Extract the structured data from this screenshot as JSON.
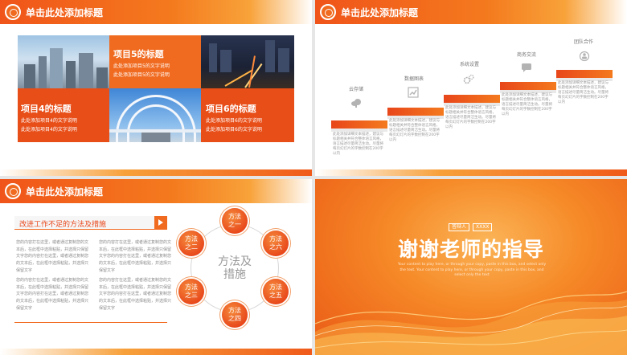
{
  "header_title": "单击此处添加标题",
  "slide1": {
    "tiles": [
      {
        "title": "项目5的标题",
        "lines": [
          "此处添加项目5的文字说明",
          "此处添加项目5的文字说明"
        ]
      },
      {
        "title": "项目4的标题",
        "lines": [
          "此处添加项目4的文字说明",
          "此处添加项目4的文字说明"
        ]
      },
      {
        "title": "项目6的标题",
        "lines": [
          "此处添加项目6的文字说明",
          "此处添加项目6的文字说明"
        ]
      }
    ]
  },
  "slide2": {
    "steps": [
      {
        "label": "云存储",
        "icon": "cloud-icon",
        "text": "此处添加详细文本描述，建议与标题相关并符合整体语言风格，语言描述尽量简洁生动。尽量将每页幻灯片的字数控制在200字以内"
      },
      {
        "label": "数据图表",
        "icon": "chart-icon",
        "text": "此处添加详细文本描述，建议与标题相关并符合整体语言风格，语言描述尽量简洁生动。尽量将每页幻灯片的字数控制在200字以内"
      },
      {
        "label": "系统设置",
        "icon": "gear-icon",
        "text": "此处添加详细文本描述，建议与标题相关并符合整体语言风格，语言描述尽量简洁生动。尽量将每页幻灯片的字数控制在200字以内"
      },
      {
        "label": "商务交流",
        "icon": "chat-icon",
        "text": "此处添加详细文本描述，建议与标题相关并符合整体语言风格，语言描述尽量简洁生动。尽量将每页幻灯片的字数控制在200字以内"
      },
      {
        "label": "团队合作",
        "icon": "team-icon",
        "text": "此处添加详细文本描述，建议与标题相关并符合整体语言风格，语言描述尽量简洁生动。尽量将每页幻灯片的字数控制在200字以内"
      }
    ]
  },
  "slide3": {
    "banner": "改进工作不足的方法及措施",
    "paragraphs": [
      "您的内容打在这里，或者通过复制您的文本后，在此框中选择粘贴，并选择只保留文字您的内容打在这里，或者通过复制您的文本后，在此框中选择粘贴，并选择只保留文字",
      "您的内容打在这里，或者通过复制您的文本后，在此框中选择粘贴，并选择只保留文字您的内容打在这里，或者通过复制您的文本后，在此框中选择粘贴，并选择只保留文字",
      "您的内容打在这里，或者通过复制您的文本后，在此框中选择粘贴，并选择只保留文字您的内容打在这里，或者通过复制您的文本后，在此框中选择粘贴，并选择只保留文字",
      "您的内容打在这里，或者通过复制您的文本后，在此框中选择粘贴，并选择只保留文字您的内容打在这里，或者通过复制您的文本后，在此框中选择粘贴，并选择只保留文字"
    ],
    "center": [
      "方法及",
      "措施"
    ],
    "nodes": [
      [
        "方法",
        "之一"
      ],
      [
        "方法",
        "之六"
      ],
      [
        "方法",
        "之五"
      ],
      [
        "方法",
        "之四"
      ],
      [
        "方法",
        "之三"
      ],
      [
        "方法",
        "之二"
      ]
    ]
  },
  "slide4": {
    "tag1": "答辩人",
    "tag2": "XXXX",
    "title": "谢谢老师的指导",
    "subtitle": "Your content to play here, or through your copy, paste in this box, and select only the text. Your content to play here, or through your copy, paste in this box, and select only the text"
  },
  "colors": {
    "accent": "#f06a1f",
    "accent_dark": "#e8461a"
  }
}
